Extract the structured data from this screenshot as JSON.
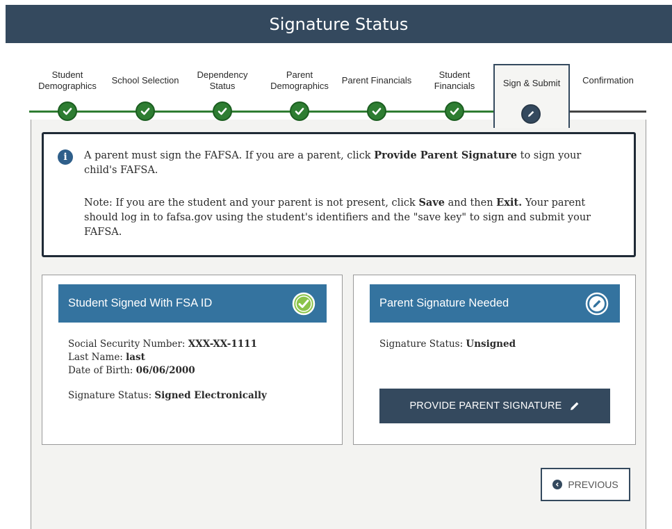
{
  "header": {
    "title": "Signature Status"
  },
  "stepper": {
    "steps": [
      {
        "label": "Student Demographics",
        "state": "complete"
      },
      {
        "label": "School Selection",
        "state": "complete"
      },
      {
        "label": "Dependency Status",
        "state": "complete"
      },
      {
        "label": "Parent Demographics",
        "state": "complete"
      },
      {
        "label": "Parent Financials",
        "state": "complete"
      },
      {
        "label": "Student Financials",
        "state": "complete"
      },
      {
        "label": "Sign & Submit",
        "state": "current"
      },
      {
        "label": "Confirmation",
        "state": "upcoming"
      }
    ]
  },
  "info": {
    "p1_a": "A parent must sign the FAFSA. If you are a parent, click ",
    "p1_b": "Provide Parent Signature",
    "p1_c": " to sign your child's FAFSA.",
    "p2_a": "Note: If you are the student and your parent is not present, click ",
    "p2_b": "Save",
    "p2_c": " and then ",
    "p2_d": "Exit.",
    "p2_e": " Your parent should log in to fafsa.gov using the student's identifiers and the \"save key\" to sign and submit your FAFSA."
  },
  "student_card": {
    "title": "Student Signed With FSA ID",
    "ssn_label": "Social Security Number: ",
    "ssn_value": "XXX-XX-1111",
    "last_name_label": "Last Name: ",
    "last_name_value": "last",
    "dob_label": "Date of Birth: ",
    "dob_value": "06/06/2000",
    "status_label": "Signature Status: ",
    "status_value": "Signed Electronically"
  },
  "parent_card": {
    "title": "Parent Signature Needed",
    "status_label": "Signature Status: ",
    "status_value": "Unsigned",
    "button_label": "PROVIDE PARENT SIGNATURE"
  },
  "navigation": {
    "previous_label": "PREVIOUS"
  },
  "colors": {
    "header": "#34495e",
    "card_header": "#34739f",
    "complete": "#2e7d32",
    "signed_badge": "#8bc34a"
  }
}
